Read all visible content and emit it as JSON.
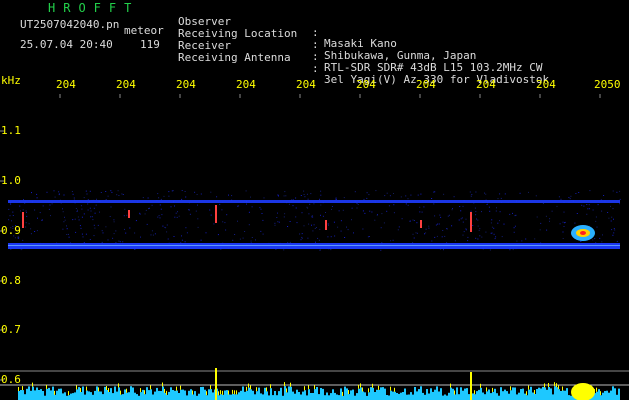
{
  "header": {
    "logo": "HROFFT",
    "filename": "UT2507042040.pn",
    "subtitle": "meteor",
    "datetime": "25.07.04 20:40",
    "count": "119",
    "info": [
      {
        "label": "Observer",
        "value": "Masaki Kano"
      },
      {
        "label": "Receiving Location",
        "value": "Shibukawa, Gunma, Japan"
      },
      {
        "label": "Receiver",
        "value": "RTL-SDR SDR# 43dB L15 103.2MHz CW"
      },
      {
        "label": "Receiving Antenna",
        "value": "3el Yagi(V) Az 330 for Vladivostok"
      }
    ]
  },
  "axis": {
    "y_unit": "kHz",
    "y_labels": [
      "1.1",
      "1.0",
      "0.9",
      "0.8",
      "0.7",
      "0.6"
    ],
    "x_labels": [
      "204",
      "204",
      "204",
      "204",
      "204",
      "204",
      "204",
      "204",
      "204",
      "2050"
    ]
  },
  "colors": {
    "background": "#000000",
    "text": "#dcdcdc",
    "logo": "#22d04a",
    "axis_labels": "#ffff00",
    "bands": "#1e3cff",
    "gridline": "#8a8a8a",
    "bottom_strip": "#1ec8ff"
  }
}
